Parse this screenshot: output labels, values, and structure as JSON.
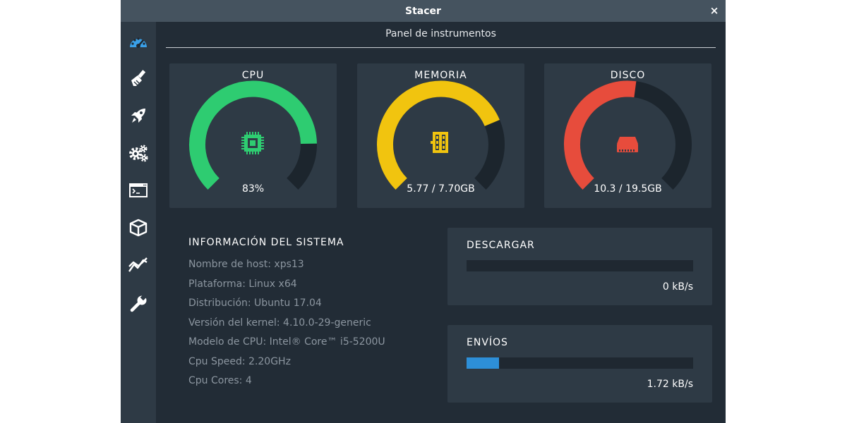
{
  "window": {
    "title": "Stacer",
    "close_glyph": "×"
  },
  "sidebar": {
    "items": [
      {
        "icon": "dashboard-icon",
        "active": true
      },
      {
        "icon": "broom-icon"
      },
      {
        "icon": "rocket-icon"
      },
      {
        "icon": "gears-icon"
      },
      {
        "icon": "terminal-window-icon"
      },
      {
        "icon": "package-box-icon"
      },
      {
        "icon": "line-chart-icon"
      },
      {
        "icon": "wrench-icon"
      }
    ]
  },
  "header": {
    "title": "Panel de instrumentos"
  },
  "gauges": {
    "cpu": {
      "title": "CPU",
      "value_text": "83%",
      "fill_fraction": 0.83,
      "color": "#2ecc71",
      "icon": "cpu-chip-icon"
    },
    "memory": {
      "title": "MEMORIA",
      "value_text": "5.77 / 7.70GB",
      "fill_fraction": 0.749,
      "color": "#f1c40f",
      "icon": "ram-stick-icon"
    },
    "disk": {
      "title": "DISCO",
      "value_text": "10.3 / 19.5GB",
      "fill_fraction": 0.528,
      "color": "#e74c3c",
      "icon": "hard-drive-icon"
    }
  },
  "colors": {
    "gauge_track": "#1c252d",
    "accent_blue": "#2d8fd8",
    "background": "#222c36",
    "panel": "#2e3a45"
  },
  "system_info": {
    "title": "INFORMACIÓN DEL SISTEMA",
    "rows": [
      "Nombre de host: xps13",
      "Plataforma: Linux x64",
      "Distribución: Ubuntu 17.04",
      "Versión del kernel: 4.10.0-29-generic",
      "Modelo de CPU: Intel® Core™ i5-5200U",
      "Cpu Speed: 2.20GHz",
      "Cpu Cores: 4"
    ]
  },
  "network": {
    "download": {
      "title": "DESCARGAR",
      "value_text": "0 kB/s",
      "fill_fraction": 0.0
    },
    "upload": {
      "title": "ENVÍOS",
      "value_text": "1.72 kB/s",
      "fill_fraction": 0.143
    }
  }
}
